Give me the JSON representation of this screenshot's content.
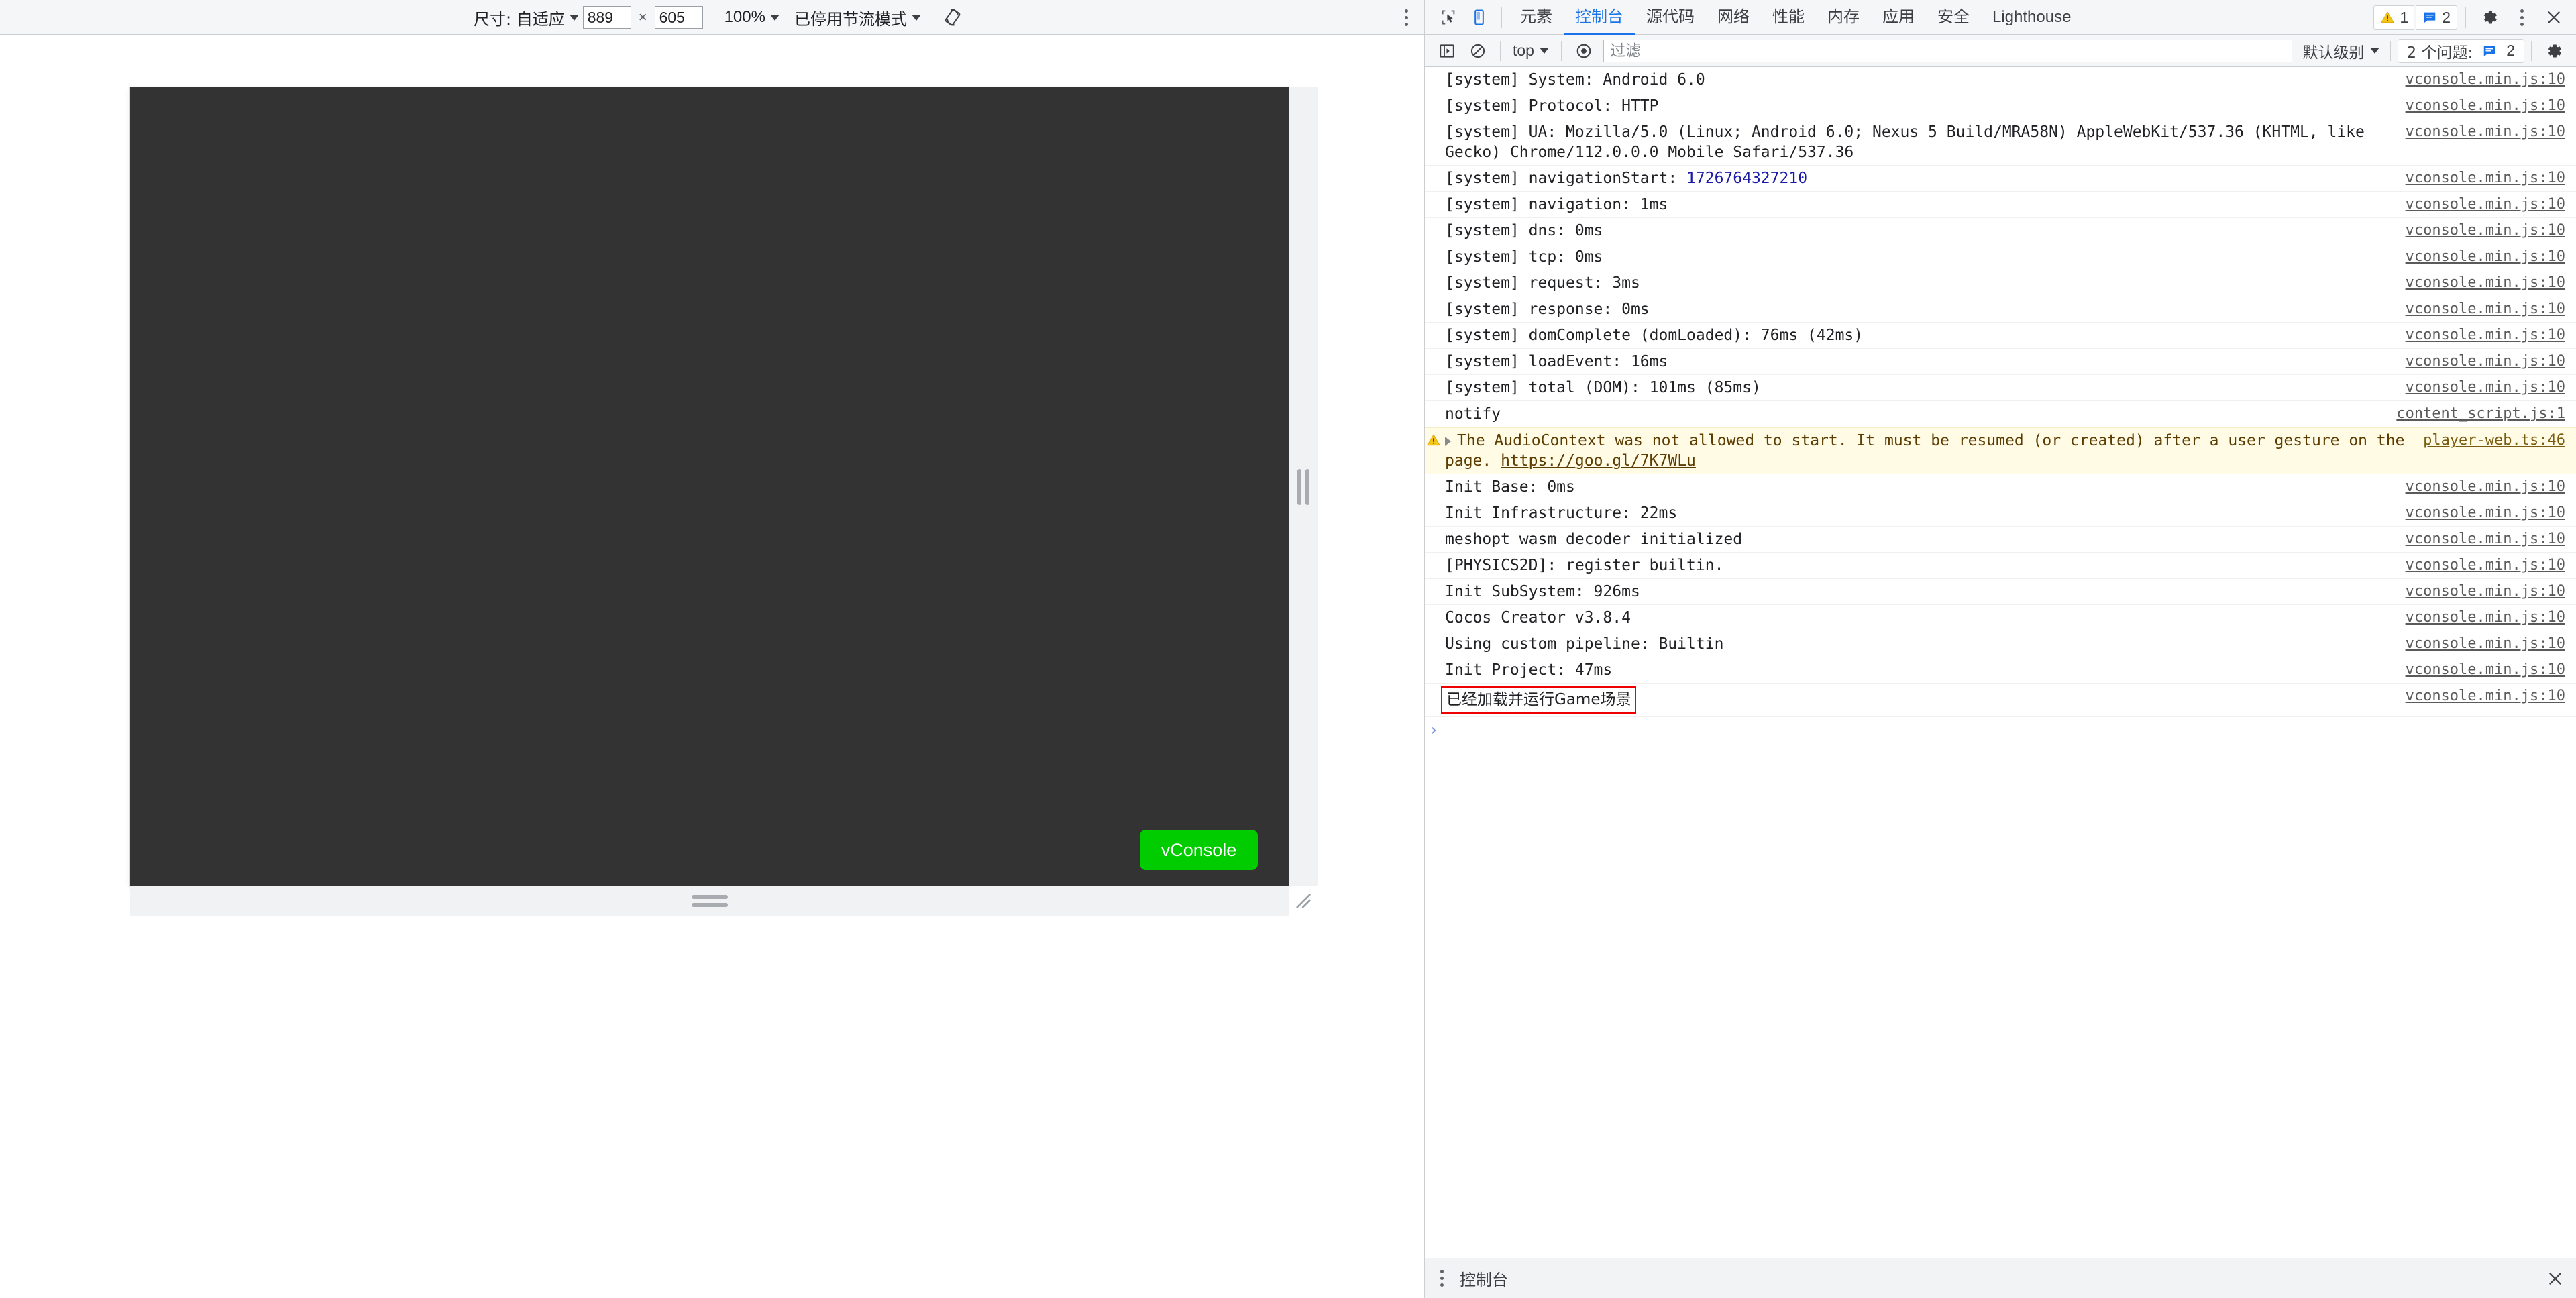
{
  "device_toolbar": {
    "size_label": "尺寸: 自适应",
    "width_value": "889",
    "height_value": "605",
    "x_separator": "×",
    "zoom_label": "100%",
    "throttling_label": "已停用节流模式",
    "rotate_icon": "rotate-device-icon",
    "more_icon": "more-options-icon"
  },
  "device_preview": {
    "vconsole_button_label": "vConsole",
    "vconsole_color": "#00cc00",
    "screen_background": "#333333"
  },
  "devtools": {
    "left_icons": [
      "inspect-element-icon",
      "device-toolbar-icon"
    ],
    "tabs": [
      {
        "label": "元素",
        "active": false
      },
      {
        "label": "控制台",
        "active": true
      },
      {
        "label": "源代码",
        "active": false
      },
      {
        "label": "网络",
        "active": false
      },
      {
        "label": "性能",
        "active": false
      },
      {
        "label": "内存",
        "active": false
      },
      {
        "label": "应用",
        "active": false
      },
      {
        "label": "安全",
        "active": false
      },
      {
        "label": "Lighthouse",
        "active": false
      }
    ],
    "warning_count": "1",
    "issue_count": "2",
    "settings_icon": "gear-icon",
    "more_icon": "more-options-icon",
    "close_icon": "close-icon",
    "accent_color": "#1a73e8"
  },
  "console_toolbar": {
    "sidebar_toggle_icon": "console-sidebar-icon",
    "clear_icon": "clear-console-icon",
    "context_label": "top",
    "eye_icon": "live-expression-icon",
    "filter_placeholder": "过滤",
    "filter_value": "",
    "level_label": "默认级别",
    "issues_label": "2 个问题:",
    "issues_count": "2",
    "settings_icon": "gear-icon"
  },
  "console_logs": [
    {
      "text": "[system] System: Android 6.0",
      "source": "vconsole.min.js:10",
      "level": "log"
    },
    {
      "text": "[system] Protocol: HTTP",
      "source": "vconsole.min.js:10",
      "level": "log"
    },
    {
      "text": "[system] UA: Mozilla/5.0 (Linux; Android 6.0; Nexus 5 Build/MRA58N) AppleWebKit/537.36 (KHTML, like Gecko) Chrome/112.0.0.0 Mobile Safari/537.36",
      "source": "vconsole.min.js:10",
      "level": "log"
    },
    {
      "text": "[system] navigationStart: ",
      "number": "1726764327210",
      "source": "vconsole.min.js:10",
      "level": "log"
    },
    {
      "text": "[system] navigation: 1ms",
      "source": "vconsole.min.js:10",
      "level": "log"
    },
    {
      "text": "[system] dns: 0ms",
      "source": "vconsole.min.js:10",
      "level": "log"
    },
    {
      "text": "[system] tcp: 0ms",
      "source": "vconsole.min.js:10",
      "level": "log"
    },
    {
      "text": "[system] request: 3ms",
      "source": "vconsole.min.js:10",
      "level": "log"
    },
    {
      "text": "[system] response: 0ms",
      "source": "vconsole.min.js:10",
      "level": "log"
    },
    {
      "text": "[system] domComplete (domLoaded): 76ms (42ms)",
      "source": "vconsole.min.js:10",
      "level": "log"
    },
    {
      "text": "[system] loadEvent: 16ms",
      "source": "vconsole.min.js:10",
      "level": "log"
    },
    {
      "text": "[system] total (DOM): 101ms (85ms)",
      "source": "vconsole.min.js:10",
      "level": "log"
    },
    {
      "text": "notify",
      "source": "content_script.js:1",
      "level": "log"
    },
    {
      "text": "The AudioContext was not allowed to start. It must be resumed (or created) after a user gesture on the page. ",
      "link": "https://goo.gl/7K7WLu",
      "source": "player-web.ts:46",
      "level": "warning"
    },
    {
      "text": "Init Base: 0ms",
      "source": "vconsole.min.js:10",
      "level": "log"
    },
    {
      "text": "Init Infrastructure: 22ms",
      "source": "vconsole.min.js:10",
      "level": "log"
    },
    {
      "text": "meshopt wasm decoder initialized",
      "source": "vconsole.min.js:10",
      "level": "log"
    },
    {
      "text": "[PHYSICS2D]: register builtin.",
      "source": "vconsole.min.js:10",
      "level": "log"
    },
    {
      "text": "Init SubSystem: 926ms",
      "source": "vconsole.min.js:10",
      "level": "log"
    },
    {
      "text": "Cocos Creator v3.8.4",
      "source": "vconsole.min.js:10",
      "level": "log"
    },
    {
      "text": "Using custom pipeline: Builtin",
      "source": "vconsole.min.js:10",
      "level": "log"
    },
    {
      "text": "Init Project: 47ms",
      "source": "vconsole.min.js:10",
      "level": "log"
    },
    {
      "text": "已经加载并运行Game场景",
      "source": "vconsole.min.js:10",
      "level": "log",
      "highlighted": true,
      "highlight_color": "#ee0000",
      "cjk": true
    }
  ],
  "console_prompt": {
    "caret": "›"
  },
  "drawer": {
    "more_icon": "more-options-icon",
    "tab_label": "控制台",
    "close_icon": "close-icon"
  }
}
